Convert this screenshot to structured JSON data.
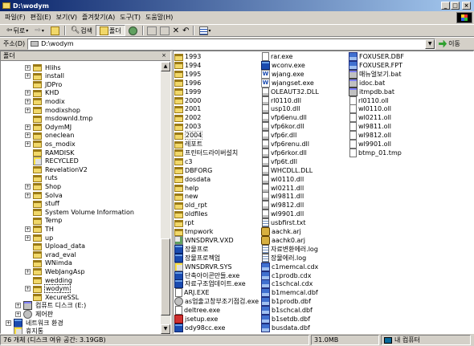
{
  "window": {
    "title": "D:\\wodym",
    "min": "_",
    "max": "□",
    "close": "×"
  },
  "menu": [
    "파일(F)",
    "편집(E)",
    "보기(V)",
    "즐겨찾기(A)",
    "도구(T)",
    "도움말(H)"
  ],
  "toolbar": {
    "back": "뒤로",
    "search": "검색",
    "folders": "폴더"
  },
  "address": {
    "label": "주소(D)",
    "value": "D:\\wodym",
    "go": "이동"
  },
  "left_pane": {
    "title": "폴더",
    "close": "×"
  },
  "tree": [
    {
      "label": "Hlihs",
      "expand": "+",
      "icon": "folder"
    },
    {
      "label": "install",
      "expand": "+",
      "icon": "folder"
    },
    {
      "label": "JDPro",
      "expand": "",
      "icon": "folder"
    },
    {
      "label": "KHD",
      "expand": "+",
      "icon": "folder"
    },
    {
      "label": "modix",
      "expand": "+",
      "icon": "folder"
    },
    {
      "label": "modixshop",
      "expand": "+",
      "icon": "folder"
    },
    {
      "label": "msdownld.tmp",
      "expand": "",
      "icon": "folder"
    },
    {
      "label": "OdymMJ",
      "expand": "+",
      "icon": "folder"
    },
    {
      "label": "oneclean",
      "expand": "+",
      "icon": "folder"
    },
    {
      "label": "os_modix",
      "expand": "+",
      "icon": "folder"
    },
    {
      "label": "RAMDISK",
      "expand": "",
      "icon": "folder"
    },
    {
      "label": "RECYCLED",
      "expand": "",
      "icon": "recycle"
    },
    {
      "label": "RevelationV2",
      "expand": "",
      "icon": "folder"
    },
    {
      "label": "ruts",
      "expand": "",
      "icon": "folder"
    },
    {
      "label": "Shop",
      "expand": "+",
      "icon": "folder"
    },
    {
      "label": "Solva",
      "expand": "+",
      "icon": "folder"
    },
    {
      "label": "stuff",
      "expand": "",
      "icon": "folder"
    },
    {
      "label": "System Volume Information",
      "expand": "",
      "icon": "folder"
    },
    {
      "label": "Temp",
      "expand": "",
      "icon": "folder"
    },
    {
      "label": "TH",
      "expand": "+",
      "icon": "folder"
    },
    {
      "label": "up",
      "expand": "+",
      "icon": "folder"
    },
    {
      "label": "Upload_data",
      "expand": "",
      "icon": "folder"
    },
    {
      "label": "vrad_eval",
      "expand": "",
      "icon": "folder"
    },
    {
      "label": "WNimda",
      "expand": "",
      "icon": "folder"
    },
    {
      "label": "WebJangAsp",
      "expand": "+",
      "icon": "folder"
    },
    {
      "label": "wedding",
      "expand": "",
      "icon": "folder"
    },
    {
      "label": "wodym",
      "expand": "+",
      "icon": "folder-open"
    },
    {
      "label": "XecureSSL",
      "expand": "",
      "icon": "folder"
    },
    {
      "label": "컴퓨트 디스크 (E:)",
      "expand": "+",
      "icon": "drive"
    },
    {
      "label": "제어판",
      "expand": "+",
      "icon": "control"
    },
    {
      "label": "네트워크 환경",
      "expand": "+",
      "icon": "network"
    },
    {
      "label": "휴지통",
      "expand": "",
      "icon": "recycle"
    }
  ],
  "files": {
    "col1": [
      {
        "name": "1993",
        "type": "folder"
      },
      {
        "name": "1994",
        "type": "folder"
      },
      {
        "name": "1995",
        "type": "folder"
      },
      {
        "name": "1996",
        "type": "folder"
      },
      {
        "name": "1999",
        "type": "folder"
      },
      {
        "name": "2000",
        "type": "folder"
      },
      {
        "name": "2001",
        "type": "folder"
      },
      {
        "name": "2002",
        "type": "folder"
      },
      {
        "name": "2003",
        "type": "folder"
      },
      {
        "name": "2004",
        "type": "folder-sel"
      },
      {
        "name": "레포트",
        "type": "folder"
      },
      {
        "name": "프린터드라이버설치",
        "type": "folder"
      },
      {
        "name": "c3",
        "type": "folder"
      },
      {
        "name": "DBFORG",
        "type": "folder"
      },
      {
        "name": "dosdata",
        "type": "folder"
      },
      {
        "name": "help",
        "type": "folder"
      },
      {
        "name": "new",
        "type": "folder"
      },
      {
        "name": "old_rpt",
        "type": "folder"
      },
      {
        "name": "oldfiles",
        "type": "folder"
      },
      {
        "name": "rpt",
        "type": "folder"
      },
      {
        "name": "tmpwork",
        "type": "folder"
      },
      {
        "name": "WNSDRVR.VXD",
        "type": "vxd"
      },
      {
        "name": "장물프로",
        "type": "exe"
      },
      {
        "name": "장물프로젝업",
        "type": "exe"
      },
      {
        "name": "WNSDRVR.SYS",
        "type": "sys"
      },
      {
        "name": "단축아이콘만들.exe",
        "type": "exe"
      },
      {
        "name": "자료구조업데이트.exe",
        "type": "exe"
      },
      {
        "name": "ARJ.EXE",
        "type": "file"
      },
      {
        "name": "as업출고창부조기점검.exe",
        "type": "gear"
      },
      {
        "name": "deltree.exe",
        "type": "file"
      },
      {
        "name": "jsetup.exe",
        "type": "js"
      },
      {
        "name": "ody98cc.exe",
        "type": "exe"
      }
    ],
    "col2": [
      {
        "name": "rar.exe",
        "type": "file"
      },
      {
        "name": "wconv.exe",
        "type": "exe"
      },
      {
        "name": "wjang.exe",
        "type": "han"
      },
      {
        "name": "wjangset.exe",
        "type": "han"
      },
      {
        "name": "OLEAUT32.DLL",
        "type": "dll"
      },
      {
        "name": "rl0110.dll",
        "type": "dll"
      },
      {
        "name": "usp10.dll",
        "type": "dll"
      },
      {
        "name": "vfp6enu.dll",
        "type": "dll"
      },
      {
        "name": "vfp6kor.dll",
        "type": "dll"
      },
      {
        "name": "vfp6r.dll",
        "type": "dll"
      },
      {
        "name": "vfp6renu.dll",
        "type": "dll"
      },
      {
        "name": "vfp6rkor.dll",
        "type": "dll"
      },
      {
        "name": "vfp6t.dll",
        "type": "dll"
      },
      {
        "name": "WHCDLL.DLL",
        "type": "dll"
      },
      {
        "name": "wl0110.dll",
        "type": "dll"
      },
      {
        "name": "wl0211.dll",
        "type": "dll"
      },
      {
        "name": "wl9811.dll",
        "type": "dll"
      },
      {
        "name": "wl9812.dll",
        "type": "dll"
      },
      {
        "name": "wl9901.dll",
        "type": "dll"
      },
      {
        "name": "usbfirst.txt",
        "type": "txt"
      },
      {
        "name": "aachk.arj",
        "type": "arj"
      },
      {
        "name": "aachk0.arj",
        "type": "arj"
      },
      {
        "name": "자료변환에러.log",
        "type": "txt"
      },
      {
        "name": "장물에러.log",
        "type": "txt"
      },
      {
        "name": "c1memcal.cdx",
        "type": "dbf"
      },
      {
        "name": "c1prodb.cdx",
        "type": "dbf"
      },
      {
        "name": "c1schcal.cdx",
        "type": "dbf"
      },
      {
        "name": "b1memcal.dbf",
        "type": "dbf"
      },
      {
        "name": "b1prodb.dbf",
        "type": "dbf"
      },
      {
        "name": "b1schcal.dbf",
        "type": "dbf"
      },
      {
        "name": "b1setdb.dbf",
        "type": "dbf"
      },
      {
        "name": "busdata.dbf",
        "type": "dbf"
      }
    ],
    "col3": [
      {
        "name": "FOXUSER.DBF",
        "type": "dbf"
      },
      {
        "name": "FOXUSER.FPT",
        "type": "dbf"
      },
      {
        "name": "매뉴얼보기.bat",
        "type": "bat"
      },
      {
        "name": "idoc.bat",
        "type": "bat"
      },
      {
        "name": "itmpdb.bat",
        "type": "bat"
      },
      {
        "name": "rl0110.oll",
        "type": "file"
      },
      {
        "name": "wl0110.oll",
        "type": "file"
      },
      {
        "name": "wl0211.oll",
        "type": "file"
      },
      {
        "name": "wl9811.oll",
        "type": "file"
      },
      {
        "name": "wl9812.oll",
        "type": "file"
      },
      {
        "name": "wl9901.oll",
        "type": "file"
      },
      {
        "name": "btmp_01.tmp",
        "type": "file"
      }
    ]
  },
  "status": {
    "count": "76 개체 (디스크 여유 공간: 3.19GB)",
    "size": "31.0MB",
    "location": "내 컴퓨터"
  }
}
